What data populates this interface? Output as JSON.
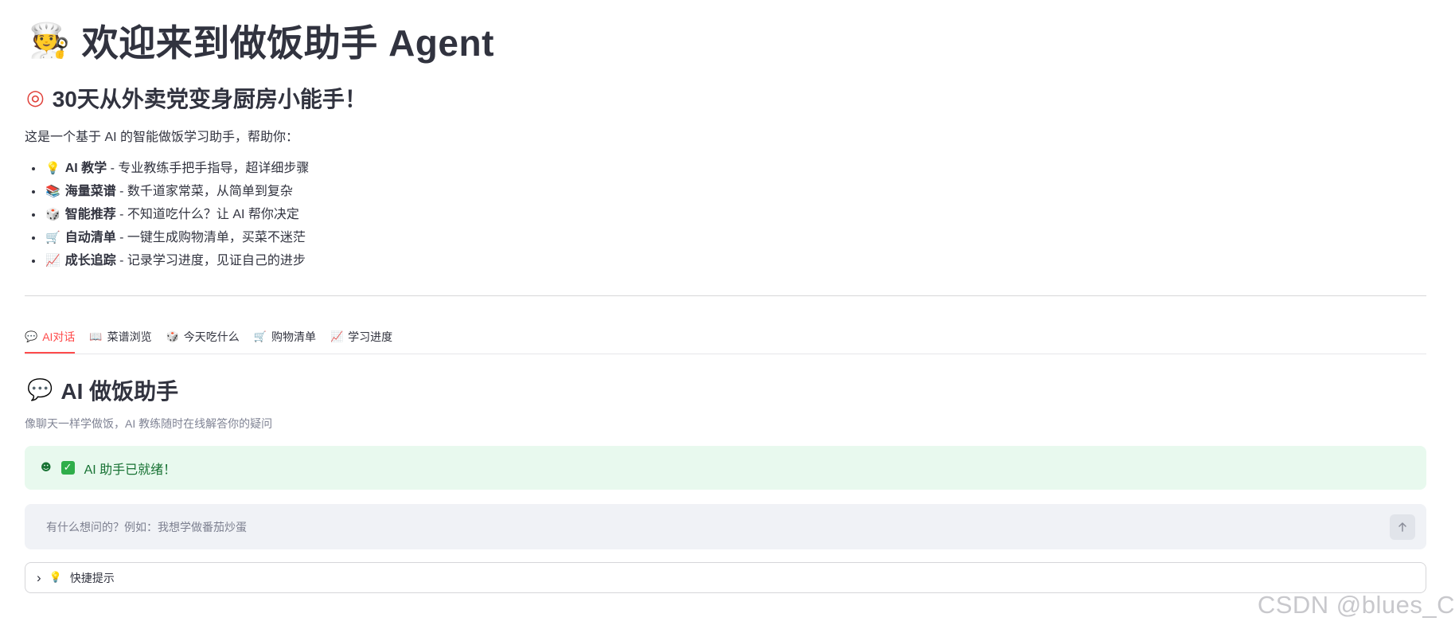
{
  "header": {
    "title_icon": "chef-icon",
    "title_emoji": "🧑‍🍳",
    "title": "欢迎来到做饭助手 Agent",
    "subtitle_icon": "target-icon",
    "subtitle_emoji": "◎",
    "subtitle": "30天从外卖党变身厨房小能手！"
  },
  "intro": "这是一个基于 AI 的智能做饭学习助手，帮助你：",
  "features": [
    {
      "icon": "lightbulb-icon",
      "emoji": "💡",
      "title": "AI 教学",
      "desc": " - 专业教练手把手指导，超详细步骤"
    },
    {
      "icon": "books-icon",
      "emoji": "📚",
      "title": "海量菜谱",
      "desc": " - 数千道家常菜，从简单到复杂"
    },
    {
      "icon": "dice-icon",
      "emoji": "🎲",
      "title": "智能推荐",
      "desc": " - 不知道吃什么？让 AI 帮你决定"
    },
    {
      "icon": "cart-icon",
      "emoji": "🛒",
      "title": "自动清单",
      "desc": " - 一键生成购物清单，买菜不迷茫"
    },
    {
      "icon": "chart-icon",
      "emoji": "📈",
      "title": "成长追踪",
      "desc": " - 记录学习进度，见证自己的进步"
    }
  ],
  "tabs": [
    {
      "icon": "speech-bubble-icon",
      "emoji": "💬",
      "label": "AI对话",
      "active": true
    },
    {
      "icon": "book-icon",
      "emoji": "📖",
      "label": "菜谱浏览",
      "active": false
    },
    {
      "icon": "dice-icon",
      "emoji": "🎲",
      "label": "今天吃什么",
      "active": false
    },
    {
      "icon": "cart-icon",
      "emoji": "🛒",
      "label": "购物清单",
      "active": false
    },
    {
      "icon": "chart-icon",
      "emoji": "📈",
      "label": "学习进度",
      "active": false
    }
  ],
  "chat": {
    "section_icon": "speech-bubble-icon",
    "section_emoji": "💬",
    "section_title": "AI 做饭助手",
    "caption": "像聊天一样学做饭，AI 教练随时在线解答你的疑问",
    "status_icon": "robot-icon",
    "status_emoji": "☻",
    "status_check": "✓",
    "status_text": "AI 助手已就绪！",
    "input_placeholder": "有什么想问的？例如：我想学做番茄炒蛋",
    "input_value": ""
  },
  "expander": {
    "chevron": "›",
    "icon": "lightbulb-icon",
    "emoji": "💡",
    "label": "快捷提示"
  },
  "watermark": "CSDN @blues_C",
  "colors": {
    "accent": "#ff4b4b",
    "success_bg": "#e8f9ee",
    "success_text": "#177233",
    "input_bg": "#f0f2f6",
    "text": "#31333f",
    "muted": "#808495"
  }
}
